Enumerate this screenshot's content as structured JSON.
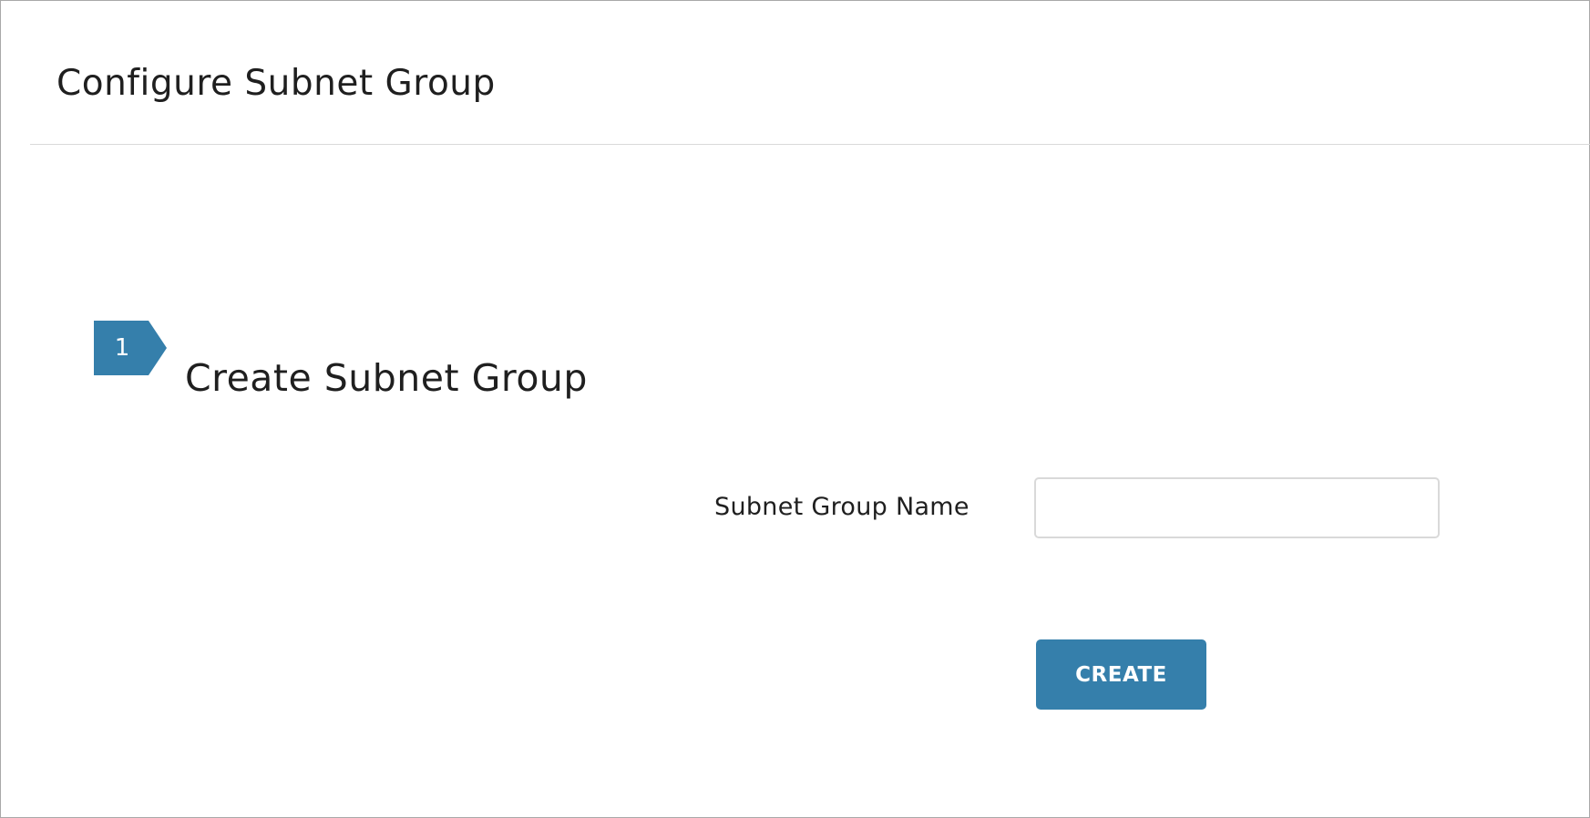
{
  "header": {
    "title": "Configure Subnet Group"
  },
  "step": {
    "number": "1",
    "title": "Create Subnet Group"
  },
  "form": {
    "subnet_group_name_label": "Subnet Group Name",
    "subnet_group_name_value": "",
    "subnet_group_name_placeholder": "",
    "create_label": "CREATE"
  },
  "colors": {
    "accent": "#357fab",
    "divider": "#d9d9d9",
    "frame_border": "#a9a9a9",
    "input_border": "#d9d9d9",
    "text": "#1f1f1f"
  }
}
